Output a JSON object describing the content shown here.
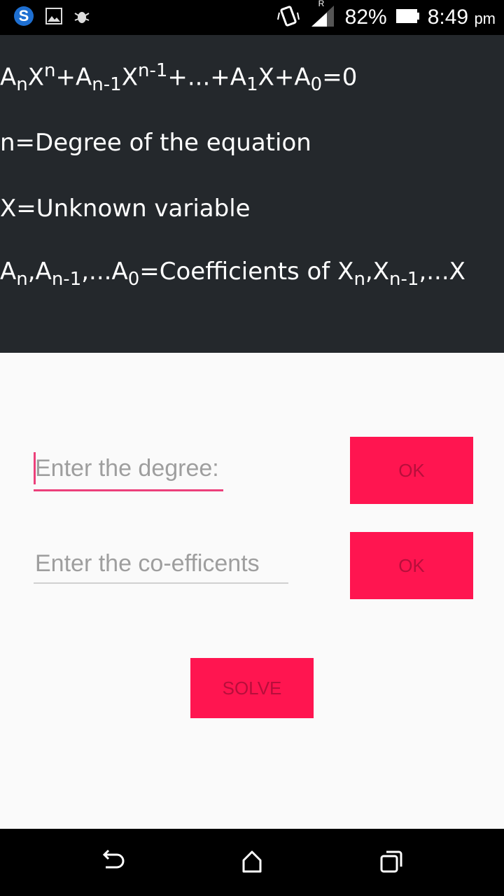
{
  "status_bar": {
    "battery_percent": "82%",
    "time": "8:49",
    "ampm": "pm",
    "roaming_indicator": "R",
    "icons": [
      "skype-icon",
      "gallery-icon",
      "bug-icon",
      "vibrate-icon",
      "signal-icon",
      "battery-icon"
    ]
  },
  "header": {
    "equation": {
      "A1": "A",
      "s1": "n",
      "X1": "X",
      "p1": "n",
      "plus1": "+A",
      "s2": "n-1",
      "X2": "X",
      "p2": "n-1",
      "mid": "+...+A",
      "s3": "1",
      "X3": "X+A",
      "s4": "0",
      "end": "=0"
    },
    "line_degree": "n=Degree of the equation",
    "line_unknown": "X=Unknown variable",
    "coeff": {
      "a": "A",
      "as1": "n",
      "b": ",A",
      "bs1": "n-1",
      "c": ",...A",
      "cs1": "0",
      "d": "=Coefficients of X",
      "ds1": "n",
      "e": ",X",
      "es1": "n-1",
      "f": ",...X"
    }
  },
  "form": {
    "degree_placeholder": "Enter the degree:",
    "degree_value": "",
    "coeff_placeholder": "Enter the co-efficents",
    "coeff_value": "",
    "ok_label_1": "OK",
    "ok_label_2": "OK",
    "solve_label": "SOLVE"
  },
  "colors": {
    "accent": "#ff1550",
    "header_bg": "#24282c",
    "content_bg": "#fafafa",
    "input_focus": "#ec407a"
  },
  "nav": {
    "icons": [
      "back-icon",
      "home-icon",
      "recents-icon"
    ]
  }
}
